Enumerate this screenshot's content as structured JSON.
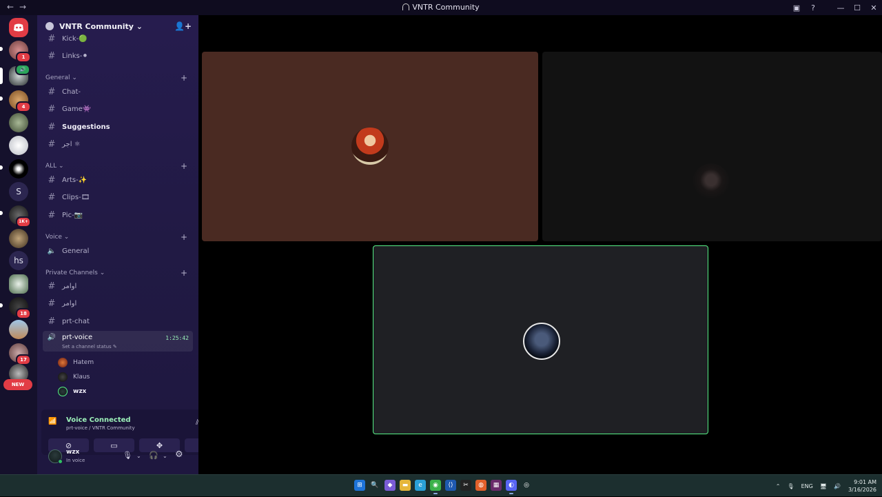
{
  "window": {
    "title": "VNTR Community",
    "nav": "←→"
  },
  "servers": {
    "badges": {
      "s2": "1",
      "s4": "4",
      "s8": "1K+",
      "s12": "18",
      "s14": "17"
    },
    "letters": {
      "s7": "S",
      "s10": "hs"
    },
    "new_label": "NEW"
  },
  "guild": {
    "name": "VNTR Community ⌄"
  },
  "categories": {
    "general": "General ⌄",
    "all": "ALL ⌄",
    "voice": "Voice ⌄",
    "private": "Private Channels ⌄"
  },
  "channels": {
    "kick": "Kick-🟢",
    "links": "Links-⚫",
    "chat": "Chat-",
    "game": "Game👾",
    "suggestions": "Suggestions",
    "ajr": "اجر ⚛",
    "arts": "Arts-✨",
    "clips": "Clips-🎞",
    "pic": "Pic-📷",
    "voice_general": "General",
    "awamer1": "اوامر",
    "awamer2": "اوامر",
    "prt_chat": "prt-chat",
    "prt_voice": "prt-voice",
    "prt_voice_timer": "1:25:42",
    "prt_voice_status": "Set a channel status ✎"
  },
  "voice_members": [
    "Hatem",
    "Klaus",
    "wzx"
  ],
  "voice_panel": {
    "status": "Voice Connected",
    "location": "prt-voice / VNTR Community"
  },
  "user": {
    "name": "wzx",
    "status": "In voice"
  },
  "taskbar": {
    "lang": "ENG",
    "time": "9:01 AM",
    "date": "3/16/2026"
  },
  "colors": {
    "accent_green": "#57f287",
    "tile_brown": "#4a2a22",
    "tile_dark": "#121212",
    "tile_self": "#1f2024",
    "sidebar": "#241b4b"
  },
  "icons": {
    "voice_channel": "speaker-icon",
    "text_channel": "hash-icon"
  }
}
